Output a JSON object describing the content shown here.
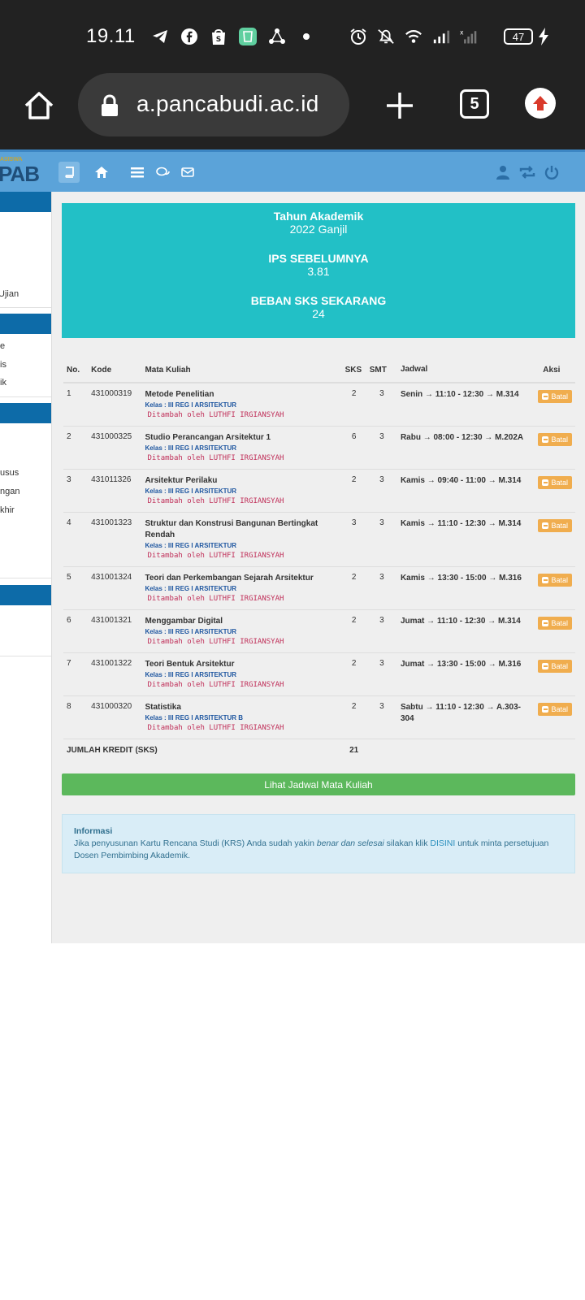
{
  "status_bar": {
    "time": "19.11",
    "battery": "47",
    "icons_left": [
      "telegram-icon",
      "facebook-icon",
      "shop-bag-icon",
      "app-icon",
      "share-icon",
      "dot-icon"
    ],
    "icons_right": [
      "alarm-icon",
      "mute-icon",
      "wifi-icon",
      "signal-icon",
      "signal-x-icon"
    ]
  },
  "browser": {
    "url": "a.pancabudi.ac.id",
    "tab_count": "5"
  },
  "app_nav": {
    "logo_text": "PAB",
    "logo_sub": "ASISWA",
    "accent_color": "#5ba3d9"
  },
  "sidebar": {
    "items": [
      "Ujian",
      "e",
      "is",
      "ik",
      "usus",
      "ngan",
      "khir"
    ]
  },
  "summary": {
    "tahun_label": "Tahun Akademik",
    "tahun_value": "2022 Ganjil",
    "ips_label": "IPS SEBELUMNYA",
    "ips_value": "3.81",
    "beban_label": "BEBAN SKS SEKARANG",
    "beban_value": "24"
  },
  "table": {
    "headers": {
      "no": "No.",
      "kode": "Kode",
      "mk": "Mata Kuliah",
      "sks": "SKS",
      "smt": "SMT",
      "jadwal": "Jadwal",
      "aksi": "Aksi"
    },
    "action_label": "Batal",
    "rows": [
      {
        "no": "1",
        "kode": "431000319",
        "name": "Metode Penelitian",
        "kelas": "Kelas : III REG I ARSITEKTUR",
        "added": "Ditambah oleh LUTHFI IRGIANSYAH",
        "sks": "2",
        "smt": "3",
        "jadwal": "Senin → 11:10 - 12:30 → M.314"
      },
      {
        "no": "2",
        "kode": "431000325",
        "name": "Studio Perancangan Arsitektur 1",
        "kelas": "Kelas : III REG I ARSITEKTUR",
        "added": "Ditambah oleh LUTHFI IRGIANSYAH",
        "sks": "6",
        "smt": "3",
        "jadwal": "Rabu → 08:00 - 12:30 → M.202A"
      },
      {
        "no": "3",
        "kode": "431011326",
        "name": "Arsitektur Perilaku",
        "kelas": "Kelas : III REG I ARSITEKTUR",
        "added": "Ditambah oleh LUTHFI IRGIANSYAH",
        "sks": "2",
        "smt": "3",
        "jadwal": "Kamis → 09:40 - 11:00 → M.314"
      },
      {
        "no": "4",
        "kode": "431001323",
        "name": "Struktur dan Konstrusi Bangunan Bertingkat Rendah",
        "kelas": "Kelas : III REG I ARSITEKTUR",
        "added": "Ditambah oleh LUTHFI IRGIANSYAH",
        "sks": "3",
        "smt": "3",
        "jadwal": "Kamis → 11:10 - 12:30 → M.314"
      },
      {
        "no": "5",
        "kode": "431001324",
        "name": "Teori dan Perkembangan Sejarah Arsitektur",
        "kelas": "Kelas : III REG I ARSITEKTUR",
        "added": "Ditambah oleh LUTHFI IRGIANSYAH",
        "sks": "2",
        "smt": "3",
        "jadwal": "Kamis → 13:30 - 15:00 → M.316"
      },
      {
        "no": "6",
        "kode": "431001321",
        "name": "Menggambar Digital",
        "kelas": "Kelas : III REG I ARSITEKTUR",
        "added": "Ditambah oleh LUTHFI IRGIANSYAH",
        "sks": "2",
        "smt": "3",
        "jadwal": "Jumat → 11:10 - 12:30 → M.314"
      },
      {
        "no": "7",
        "kode": "431001322",
        "name": "Teori Bentuk Arsitektur",
        "kelas": "Kelas : III REG I ARSITEKTUR",
        "added": "Ditambah oleh LUTHFI IRGIANSYAH",
        "sks": "2",
        "smt": "3",
        "jadwal": "Jumat → 13:30 - 15:00 → M.316"
      },
      {
        "no": "8",
        "kode": "431000320",
        "name": "Statistika",
        "kelas": "Kelas : III REG I ARSITEKTUR B",
        "added": "Ditambah oleh LUTHFI IRGIANSYAH",
        "sks": "2",
        "smt": "3",
        "jadwal": "Sabtu → 11:10 - 12:30 → A.303-304"
      }
    ],
    "total_label": "JUMLAH KREDIT (SKS)",
    "total_value": "21"
  },
  "jadwal_button": "Lihat Jadwal Mata Kuliah",
  "info": {
    "title": "Informasi",
    "text_1": "Jika penyusunan Kartu Rencana Studi (KRS) Anda sudah yakin ",
    "text_em": "benar dan selesai",
    "text_2": " silakan klik ",
    "link": "DISINI",
    "text_3": " untuk minta persetujuan Dosen Pembimbing Akademik."
  }
}
